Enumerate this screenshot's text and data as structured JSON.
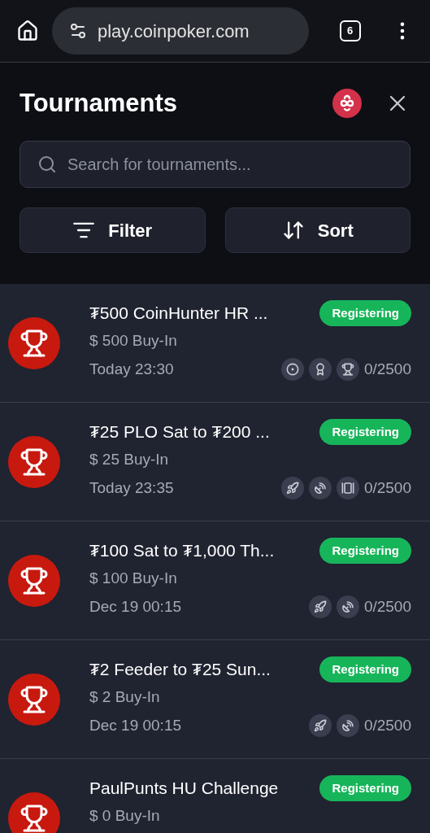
{
  "browser": {
    "url": "play.coinpoker.com",
    "tab_count": "6"
  },
  "panel": {
    "title": "Tournaments",
    "search": {
      "placeholder": "Search for tournaments..."
    },
    "buttons": [
      {
        "label": "Filter",
        "kind": "filter"
      },
      {
        "label": "Sort",
        "kind": "sort"
      }
    ]
  },
  "tournaments": [
    {
      "title": "₮500 CoinHunter HR ...",
      "buy_in": "$ 500 Buy-In",
      "start": "Today 23:30",
      "status": "Registering",
      "features": [
        {
          "kind": "target"
        },
        {
          "kind": "star"
        },
        {
          "kind": "trophy"
        }
      ],
      "entries": "0/2500"
    },
    {
      "title": "₮25 PLO Sat to ₮200 ...",
      "buy_in": "$ 25 Buy-In",
      "start": "Today 23:35",
      "status": "Registering",
      "features": [
        {
          "kind": "rocket"
        },
        {
          "kind": "dish"
        },
        {
          "kind": "cards"
        }
      ],
      "entries": "0/2500"
    },
    {
      "title": "₮100 Sat to ₮1,000 Th...",
      "buy_in": "$ 100 Buy-In",
      "start": "Dec 19 00:15",
      "status": "Registering",
      "features": [
        {
          "kind": "rocket"
        },
        {
          "kind": "dish"
        }
      ],
      "entries": "0/2500"
    },
    {
      "title": "₮2 Feeder to ₮25 Sun...",
      "buy_in": "$ 2 Buy-In",
      "start": "Dec 19 00:15",
      "status": "Registering",
      "features": [
        {
          "kind": "rocket"
        },
        {
          "kind": "dish"
        }
      ],
      "entries": "0/2500"
    },
    {
      "title": "PaulPunts HU Challenge",
      "buy_in": "$ 0 Buy-In",
      "status": "Registering"
    }
  ]
}
